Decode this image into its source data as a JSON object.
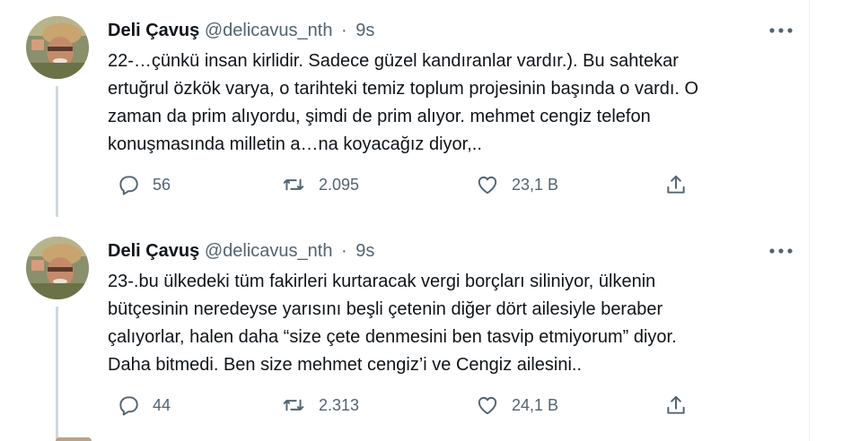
{
  "tweets": [
    {
      "author_name": "Deli Çavuş",
      "handle": "@delicavus_nth",
      "separator": "·",
      "time": "9s",
      "text": "22-…çünkü insan kirlidir. Sadece güzel kandıranlar vardır.). Bu sahtekar\nertuğrul özkök varya, o tarihteki temiz toplum projesinin başında o vardı. O\nzaman da prim alıyordu, şimdi de prim alıyor. mehmet cengiz telefon\nkonuşmasında milletin a…na koyacağız diyor,..",
      "replies": "56",
      "retweets": "2.095",
      "likes": "23,1 B"
    },
    {
      "author_name": "Deli Çavuş",
      "handle": "@delicavus_nth",
      "separator": "·",
      "time": "9s",
      "text": "23-.bu ülkedeki tüm fakirleri kurtaracak vergi borçları siliniyor, ülkenin\nbütçesinin neredeyse yarısını beşli çetenin diğer dört ailesiyle beraber\nçalıyorlar, halen daha “size çete denmesini ben tasvip etmiyorum” diyor.\nDaha bitmedi. Ben size mehmet cengiz’i ve Cengiz ailesini..",
      "replies": "44",
      "retweets": "2.313",
      "likes": "24,1 B"
    }
  ],
  "icons": {
    "avatar": "avatar-photo",
    "more": "more-horizontal-icon",
    "reply": "reply-icon",
    "retweet": "retweet-icon",
    "like": "heart-icon",
    "share": "share-icon"
  },
  "colors": {
    "text": "#0f1419",
    "secondary": "#536471",
    "thread_line": "#cfd9de"
  }
}
